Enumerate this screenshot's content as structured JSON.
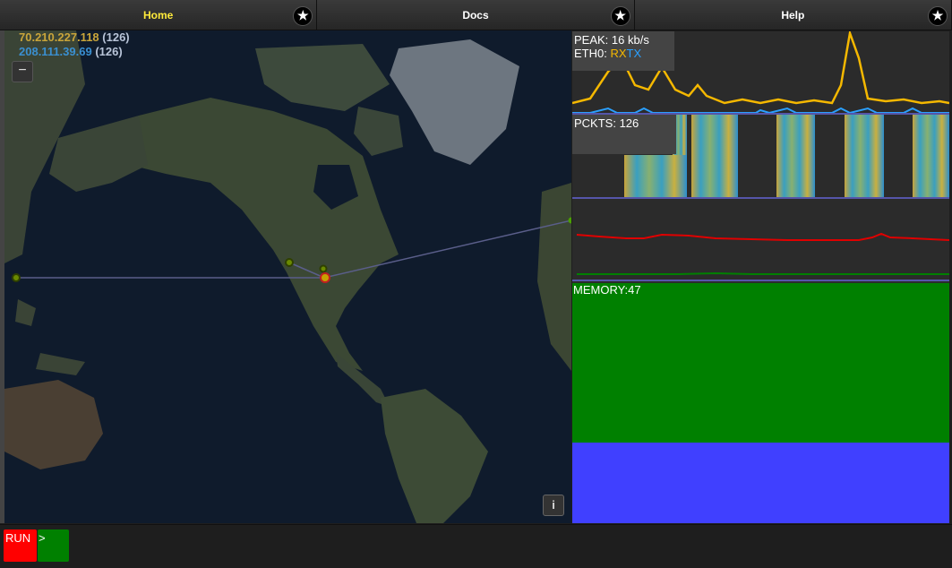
{
  "tabs": [
    {
      "label": "Home",
      "active": true
    },
    {
      "label": "Docs",
      "active": false
    },
    {
      "label": "Help",
      "active": false
    }
  ],
  "star_glyph": "★",
  "map": {
    "legend": [
      {
        "ip": "70.210.227.118",
        "count": "(126)",
        "color": "#c9a53a"
      },
      {
        "ip": "208.111.39.69",
        "count": "(126)",
        "color": "#3a8fd0"
      }
    ],
    "zoom_out_label": "−",
    "info_label": "i"
  },
  "peak_panel": {
    "peak_text": "PEAK: 16 kb/s",
    "iface_text": "ETH0:",
    "rx_label": "RX",
    "tx_label": "TX",
    "rx_color": "#f5b800",
    "tx_color": "#2aa0ff"
  },
  "pckts_panel": {
    "text": "PCKTS: 126"
  },
  "load_panel": {
    "line_colors": [
      "#e00000",
      "#008000"
    ]
  },
  "memory_panel": {
    "text": "MEMORY:47",
    "used_color": "#008000",
    "free_color": "#4040ff"
  },
  "bottom": {
    "run_label": "RUN",
    "go_label": ">"
  }
}
